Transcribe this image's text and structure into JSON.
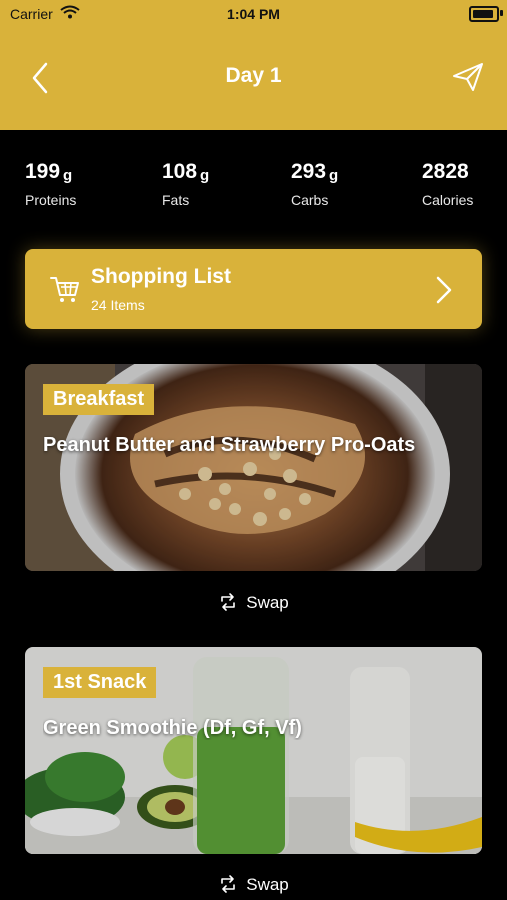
{
  "status": {
    "carrier": "Carrier",
    "time": "1:04 PM"
  },
  "nav": {
    "title": "Day 1"
  },
  "macros": [
    {
      "value": "199",
      "unit": "g",
      "label": "Proteins"
    },
    {
      "value": "108",
      "unit": "g",
      "label": "Fats"
    },
    {
      "value": "293",
      "unit": "g",
      "label": "Carbs"
    },
    {
      "value": "2828",
      "unit": "",
      "label": "Calories"
    }
  ],
  "shopping": {
    "title": "Shopping List",
    "count": "24 Items"
  },
  "meals": [
    {
      "tag": "Breakfast",
      "name": "Peanut Butter and Strawberry Pro-Oats",
      "swap": "Swap"
    },
    {
      "tag": "1st Snack",
      "name": "Green Smoothie (Df, Gf, Vf)",
      "swap": "Swap"
    }
  ],
  "colors": {
    "accent": "#D9B23A",
    "background": "#000000"
  }
}
